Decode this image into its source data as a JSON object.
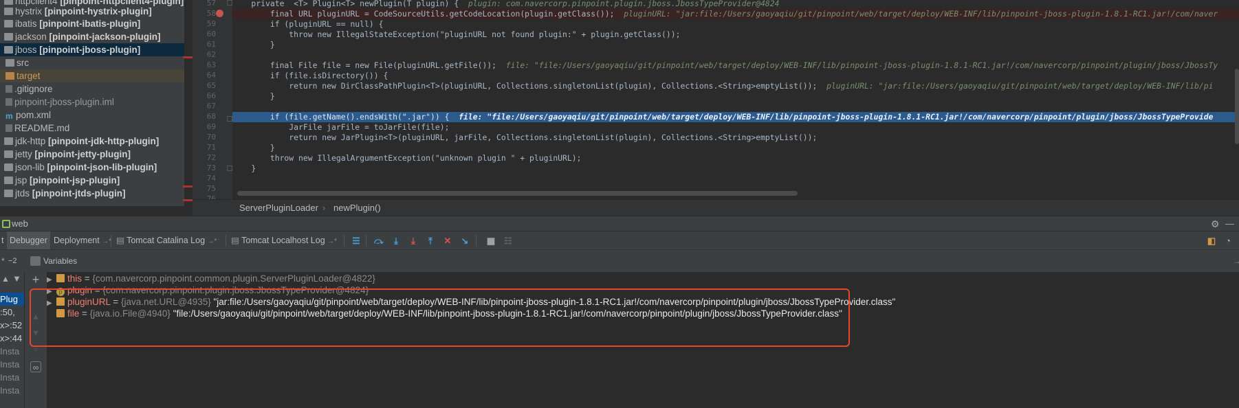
{
  "project_tree": {
    "items": [
      {
        "prefix": "httpclient4",
        "module": "[pinpoint-httpclient4-plugin]"
      },
      {
        "prefix": "hystrix",
        "module": "[pinpoint-hystrix-plugin]"
      },
      {
        "prefix": "ibatis",
        "module": "[pinpoint-ibatis-plugin]"
      },
      {
        "prefix": "jackson",
        "module": "[pinpoint-jackson-plugin]"
      },
      {
        "prefix": "jboss",
        "module": "[pinpoint-jboss-plugin]"
      },
      {
        "prefix": "src",
        "module": ""
      },
      {
        "prefix": "target",
        "module": ""
      },
      {
        "prefix": ".gitignore",
        "module": ""
      },
      {
        "prefix": "pinpoint-jboss-plugin.iml",
        "module": ""
      },
      {
        "prefix": "pom.xml",
        "module": ""
      },
      {
        "prefix": "README.md",
        "module": ""
      },
      {
        "prefix": "jdk-http",
        "module": "[pinpoint-jdk-http-plugin]"
      },
      {
        "prefix": "jetty",
        "module": "[pinpoint-jetty-plugin]"
      },
      {
        "prefix": "json-lib",
        "module": "[pinpoint-json-lib-plugin]"
      },
      {
        "prefix": "jsp",
        "module": "[pinpoint-jsp-plugin]"
      },
      {
        "prefix": "jtds",
        "module": "[pinpoint-jtds-plugin]"
      }
    ]
  },
  "editor": {
    "line_numbers": [
      "57",
      "58",
      "59",
      "60",
      "61",
      "62",
      "63",
      "64",
      "65",
      "66",
      "67",
      "68",
      "69",
      "70",
      "71",
      "72",
      "73",
      "74",
      "75",
      "76"
    ],
    "lines": [
      {
        "code": "    private  <T> Plugin<T> newPlugin(T plugin) {",
        "inline": "  plugin: com.navercorp.pinpoint.plugin.jboss.JbossTypeProvider@4824"
      },
      {
        "code": "        final URL pluginURL = CodeSourceUtils.getCodeLocation(plugin.getClass());",
        "inline": "  pluginURL: \"jar:file:/Users/gaoyaqiu/git/pinpoint/web/target/deploy/WEB-INF/lib/pinpoint-jboss-plugin-1.8.1-RC1.jar!/com/naver"
      },
      {
        "code": "        if (pluginURL == null) {",
        "inline": ""
      },
      {
        "code": "            throw new IllegalStateException(\"pluginURL not found plugin:\" + plugin.getClass());",
        "inline": ""
      },
      {
        "code": "        }",
        "inline": ""
      },
      {
        "code": "",
        "inline": ""
      },
      {
        "code": "        final File file = new File(pluginURL.getFile());",
        "inline": "  file: \"file:/Users/gaoyaqiu/git/pinpoint/web/target/deploy/WEB-INF/lib/pinpoint-jboss-plugin-1.8.1-RC1.jar!/com/navercorp/pinpoint/plugin/jboss/JbossTy"
      },
      {
        "code": "        if (file.isDirectory()) {",
        "inline": ""
      },
      {
        "code": "            return new DirClassPathPlugin<T>(pluginURL, Collections.singletonList(plugin), Collections.<String>emptyList());",
        "inline": "  pluginURL: \"jar:file:/Users/gaoyaqiu/git/pinpoint/web/target/deploy/WEB-INF/lib/pi"
      },
      {
        "code": "        }",
        "inline": ""
      },
      {
        "code": "",
        "inline": ""
      },
      {
        "code": "        if (file.getName().endsWith(\".jar\")) {",
        "inline": "  file: \"file:/Users/gaoyaqiu/git/pinpoint/web/target/deploy/WEB-INF/lib/pinpoint-jboss-plugin-1.8.1-RC1.jar!/com/navercorp/pinpoint/plugin/jboss/JbossTypeProvide"
      },
      {
        "code": "            JarFile jarFile = toJarFile(file);",
        "inline": ""
      },
      {
        "code": "            return new JarPlugin<T>(pluginURL, jarFile, Collections.singletonList(plugin), Collections.<String>emptyList());",
        "inline": ""
      },
      {
        "code": "        }",
        "inline": ""
      },
      {
        "code": "        throw new IllegalArgumentException(\"unknown plugin \" + pluginURL);",
        "inline": ""
      },
      {
        "code": "    }",
        "inline": ""
      },
      {
        "code": "",
        "inline": ""
      },
      {
        "code": "",
        "inline": ""
      },
      {
        "code": "",
        "inline": ""
      }
    ]
  },
  "breadcrumb": {
    "class_name": "ServerPluginLoader",
    "separator": "›",
    "method_name": "newPlugin()"
  },
  "tool_window": {
    "title": "web"
  },
  "tabs": {
    "first": "t",
    "debugger": "Debugger",
    "deployment": "Deployment",
    "deployment_pin": "→*",
    "catalina": "Tomcat Catalina Log",
    "catalina_pin": "→*",
    "localhost": "Tomcat Localhost Log",
    "localhost_pin": "→*"
  },
  "variables": {
    "header_label": "Variables",
    "frames_badge": "−2",
    "frames": [
      "Plug",
      ":50,",
      "x>:52",
      "x>:44",
      "Insta",
      "Insta",
      "Insta",
      "Insta"
    ],
    "rows": [
      {
        "name": "this",
        "type": "{com.navercorp.pinpoint.common.plugin.ServerPluginLoader@4822}",
        "value": ""
      },
      {
        "name": "plugin",
        "type": "{com.navercorp.pinpoint.plugin.jboss.JbossTypeProvider@4824}",
        "value": "",
        "badge": "p"
      },
      {
        "name": "pluginURL",
        "type": "{java.net.URL@4935}",
        "value": "\"jar:file:/Users/gaoyaqiu/git/pinpoint/web/target/deploy/WEB-INF/lib/pinpoint-jboss-plugin-1.8.1-RC1.jar!/com/navercorp/pinpoint/plugin/jboss/JbossTypeProvider.class\""
      },
      {
        "name": "file",
        "type": "{java.io.File@4940}",
        "value": "\"file:/Users/gaoyaqiu/git/pinpoint/web/target/deploy/WEB-INF/lib/pinpoint-jboss-plugin-1.8.1-RC1.jar!/com/navercorp/pinpoint/plugin/jboss/JbossTypeProvider.class\""
      }
    ]
  },
  "colors": {
    "accent_highlight": "#2d5a8c",
    "annotation_box": "#e8452c",
    "selection_blue": "#0d4e93"
  }
}
